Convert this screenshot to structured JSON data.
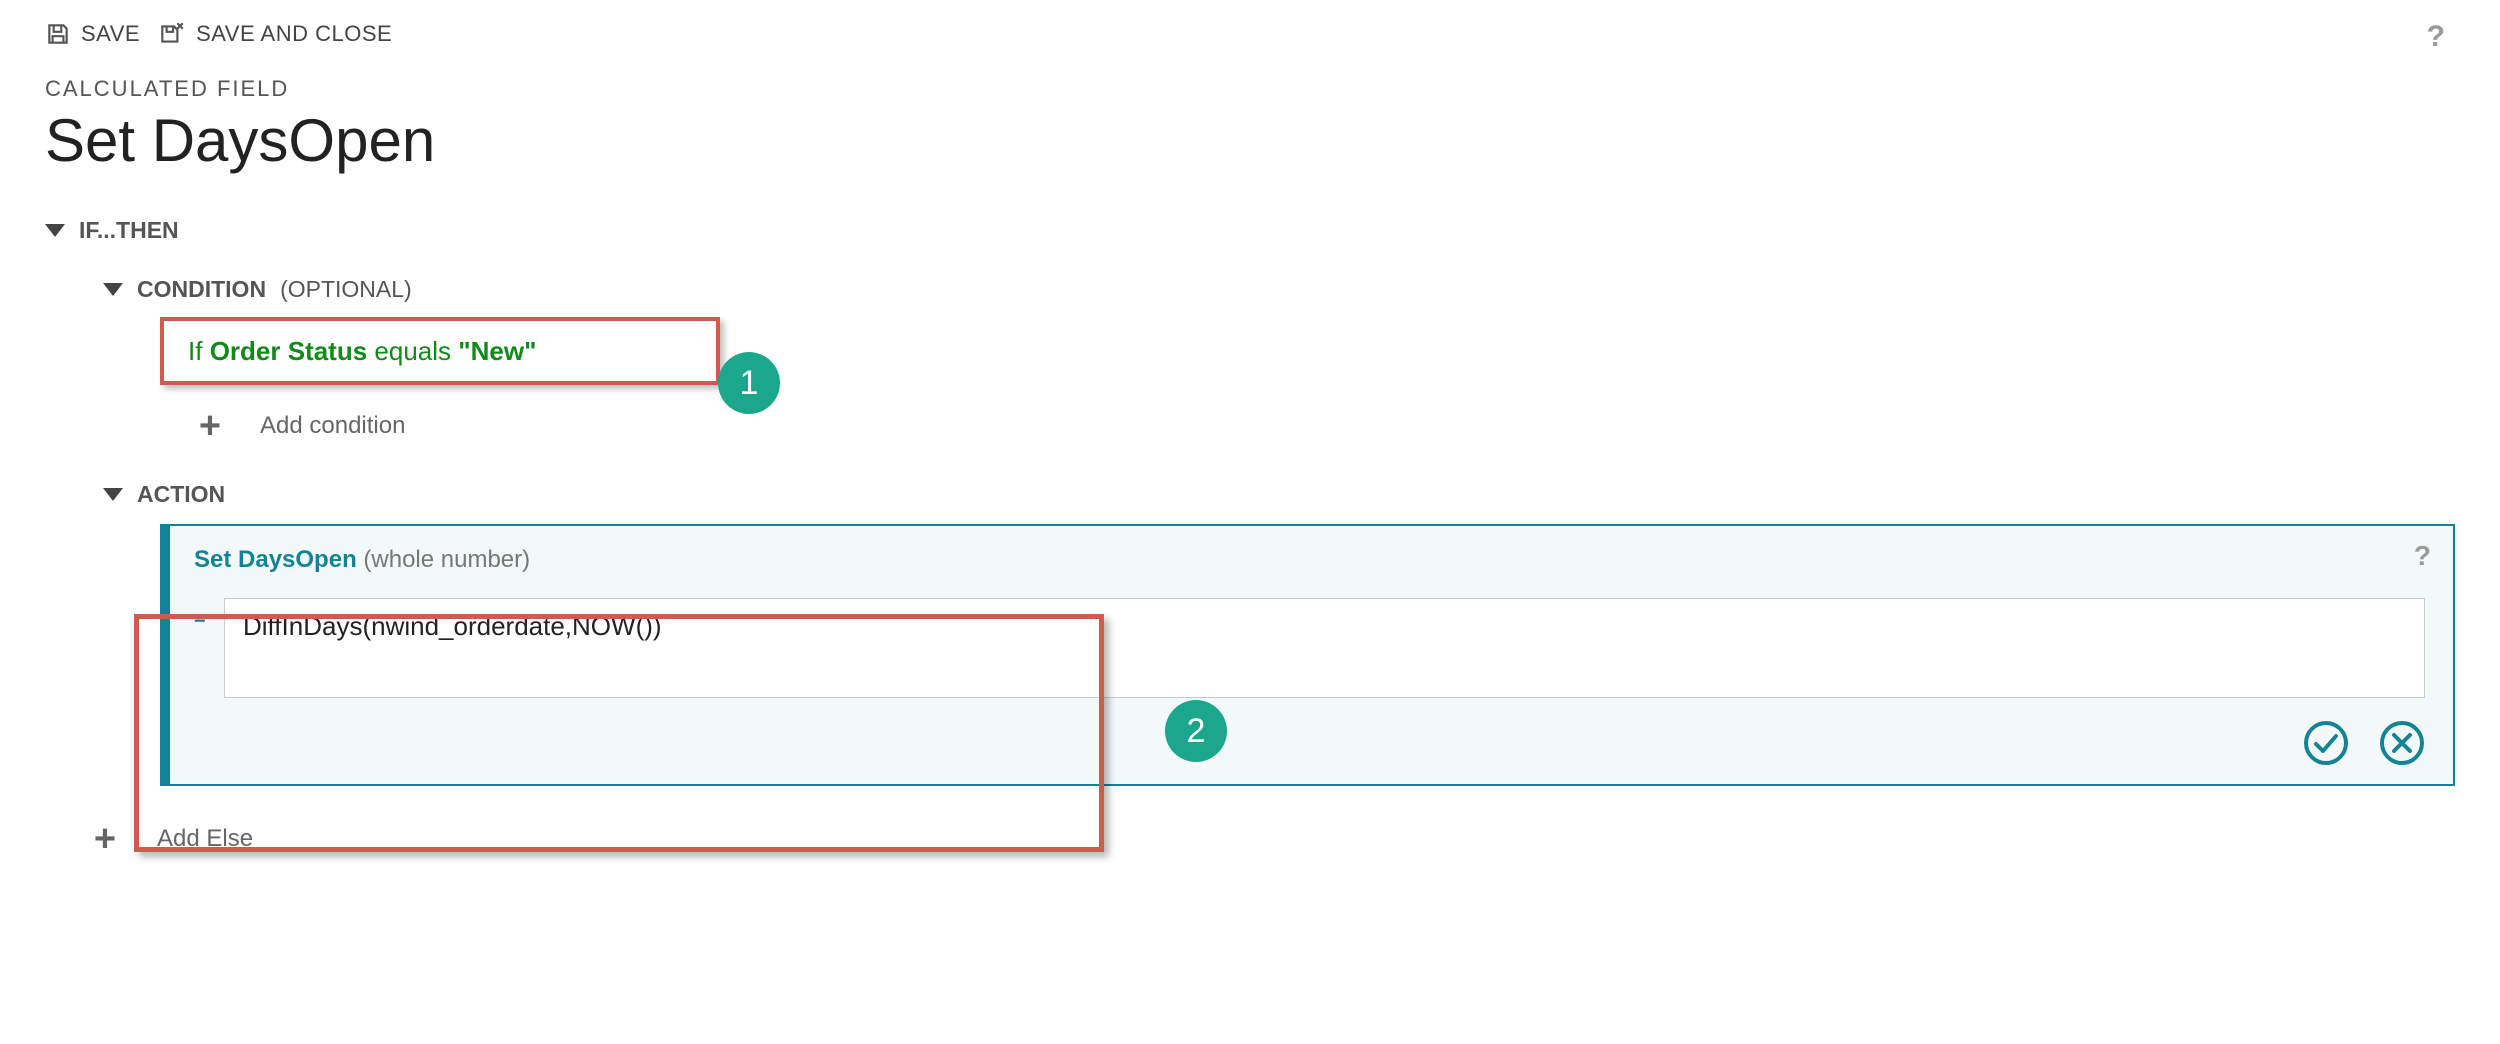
{
  "toolbar": {
    "save": "SAVE",
    "save_close": "SAVE AND CLOSE"
  },
  "header": {
    "subtitle": "CALCULATED FIELD",
    "title": "Set DaysOpen"
  },
  "sections": {
    "if_then": "IF...THEN",
    "condition": "CONDITION",
    "condition_optional": "(OPTIONAL)",
    "action": "ACTION"
  },
  "condition": {
    "if_kw": "If",
    "field": "Order Status",
    "op": "equals",
    "value": "\"New\"",
    "add_condition": "Add condition"
  },
  "action": {
    "set_name": "Set DaysOpen",
    "type": "(whole number)",
    "formula": "DiffInDays(nwind_orderdate,NOW())"
  },
  "footer": {
    "add_else": "Add Else"
  },
  "callouts": {
    "one": "1",
    "two": "2"
  }
}
